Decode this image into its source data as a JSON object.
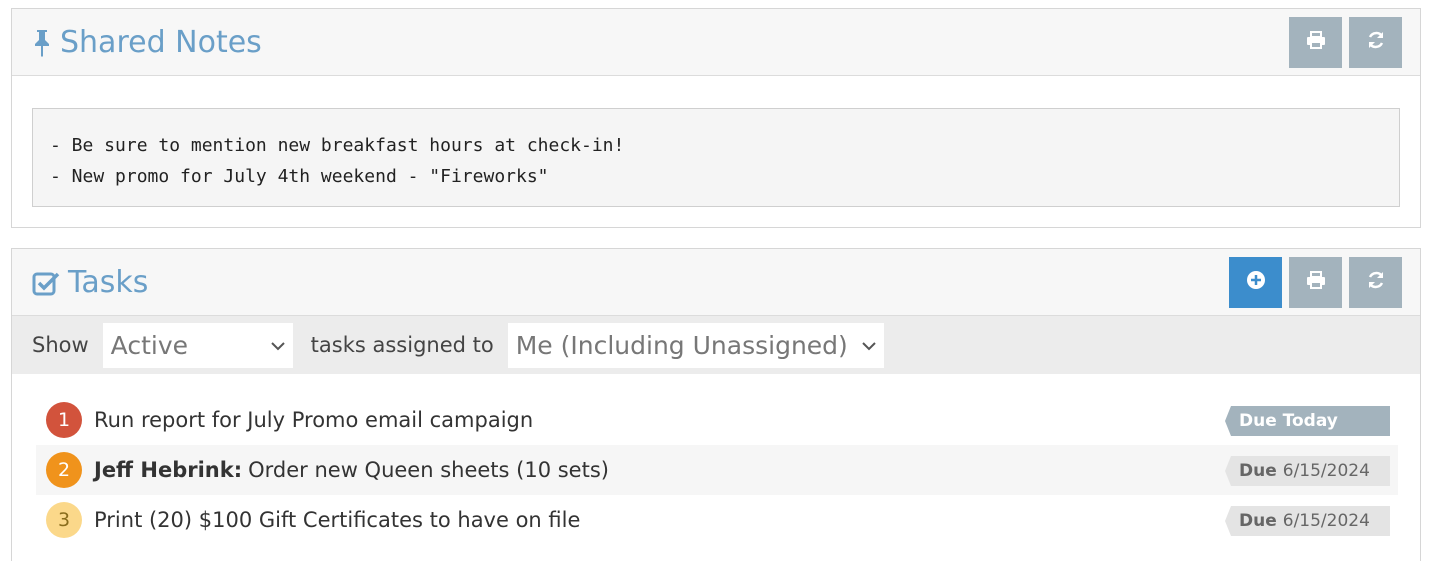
{
  "notes": {
    "title": "Shared Notes",
    "lines": [
      "- Be sure to mention new breakfast hours at check-in!",
      "- New promo for July 4th weekend - \"Fireworks\""
    ]
  },
  "tasks": {
    "title": "Tasks",
    "filter": {
      "show_label": "Show",
      "status_value": "Active",
      "assigned_label": "tasks assigned to",
      "assignee_value": "Me (Including Unassigned)"
    },
    "items": [
      {
        "number": "1",
        "assignee": "",
        "text": "Run report for July Promo email campaign",
        "due_word": "Due Today",
        "due_date": "",
        "priority_color": "#d2533c"
      },
      {
        "number": "2",
        "assignee": "Jeff Hebrink:",
        "text": "Order new Queen sheets (10 sets)",
        "due_word": "Due",
        "due_date": "6/15/2024",
        "priority_color": "#f0931c"
      },
      {
        "number": "3",
        "assignee": "",
        "text": "Print (20) $100 Gift Certificates to have on file",
        "due_word": "Due",
        "due_date": "6/15/2024",
        "priority_color": "#fbd88a"
      }
    ]
  },
  "colors": {
    "title_blue": "#6a9fc8",
    "button_gray": "#a3b3bd",
    "button_primary": "#3c8dcc"
  },
  "icons": {
    "notes_title": "pushpin-icon",
    "tasks_title": "checkbox-icon",
    "print": "print-icon",
    "refresh": "refresh-icon",
    "add": "plus-circle-icon"
  }
}
